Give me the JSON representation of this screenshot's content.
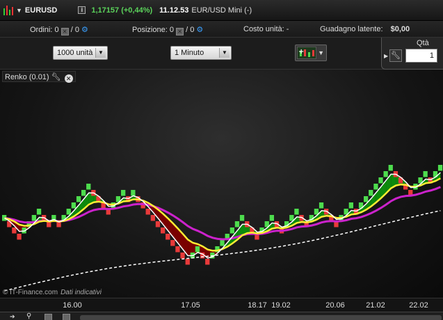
{
  "header": {
    "symbol": "EURUSD",
    "info_label": "i",
    "price_change": "1,17157 (+0,44%)",
    "time": "11.12.53",
    "instrument_name": "EUR/USD Mini (-)"
  },
  "positions": {
    "orders_label": "Ordini:",
    "orders_value": "0",
    "orders_slash": "/ 0",
    "position_label": "Posizione:",
    "position_value": "0",
    "position_slash": "/ 0",
    "unit_cost_label": "Costo unità:",
    "unit_cost_value": "-",
    "latent_gain_label": "Guadagno latente:",
    "latent_gain_value": "$0,00"
  },
  "toolbar": {
    "units_select": "1000 unità",
    "timeframe_select": "1 Minuto",
    "qty_label": "Qtà",
    "qty_value": "1"
  },
  "indicator": {
    "label": "Renko (0.01)"
  },
  "watermark": {
    "source": "© IT-Finance.com",
    "note": "Dati indicativi"
  },
  "colors": {
    "up_brick": "#4ddc4d",
    "down_brick": "#e83a3a",
    "fast_ma": "#ffffff",
    "mid_ma": "#ffee33",
    "slow_ma": "#cc22cc",
    "long_ma": "#ffffff",
    "bull_fill": "#0d8a0d",
    "bear_fill": "#7a0000"
  },
  "x_ticks": [
    "16.00",
    "17.05",
    "18.17",
    "19.02",
    "20.06",
    "21.02",
    "22.02"
  ],
  "chart_data": {
    "type": "renko",
    "brick_size": 0.01,
    "bricks": [
      1,
      -1,
      -1,
      -1,
      1,
      1,
      1,
      1,
      -1,
      -1,
      1,
      -1,
      1,
      1,
      1,
      1,
      1,
      1,
      -1,
      -1,
      -1,
      -1,
      1,
      1,
      1,
      -1,
      1,
      -1,
      -1,
      -1,
      -1,
      -1,
      -1,
      -1,
      -1,
      -1,
      -1,
      -1,
      1,
      1,
      -1,
      -1,
      1,
      1,
      1,
      1,
      1,
      1,
      1,
      -1,
      -1,
      -1,
      1,
      1,
      1,
      -1,
      -1,
      1,
      1,
      1,
      -1,
      -1,
      1,
      1,
      1,
      -1,
      -1,
      -1,
      1,
      1,
      1,
      -1,
      1,
      1,
      1,
      1,
      1,
      1,
      1,
      -1,
      -1,
      -1,
      -1,
      1,
      1,
      1,
      -1,
      1,
      1
    ],
    "x_ticks": [
      "16.00",
      "17.05",
      "18.17",
      "19.02",
      "20.06",
      "21.02",
      "22.02"
    ]
  }
}
